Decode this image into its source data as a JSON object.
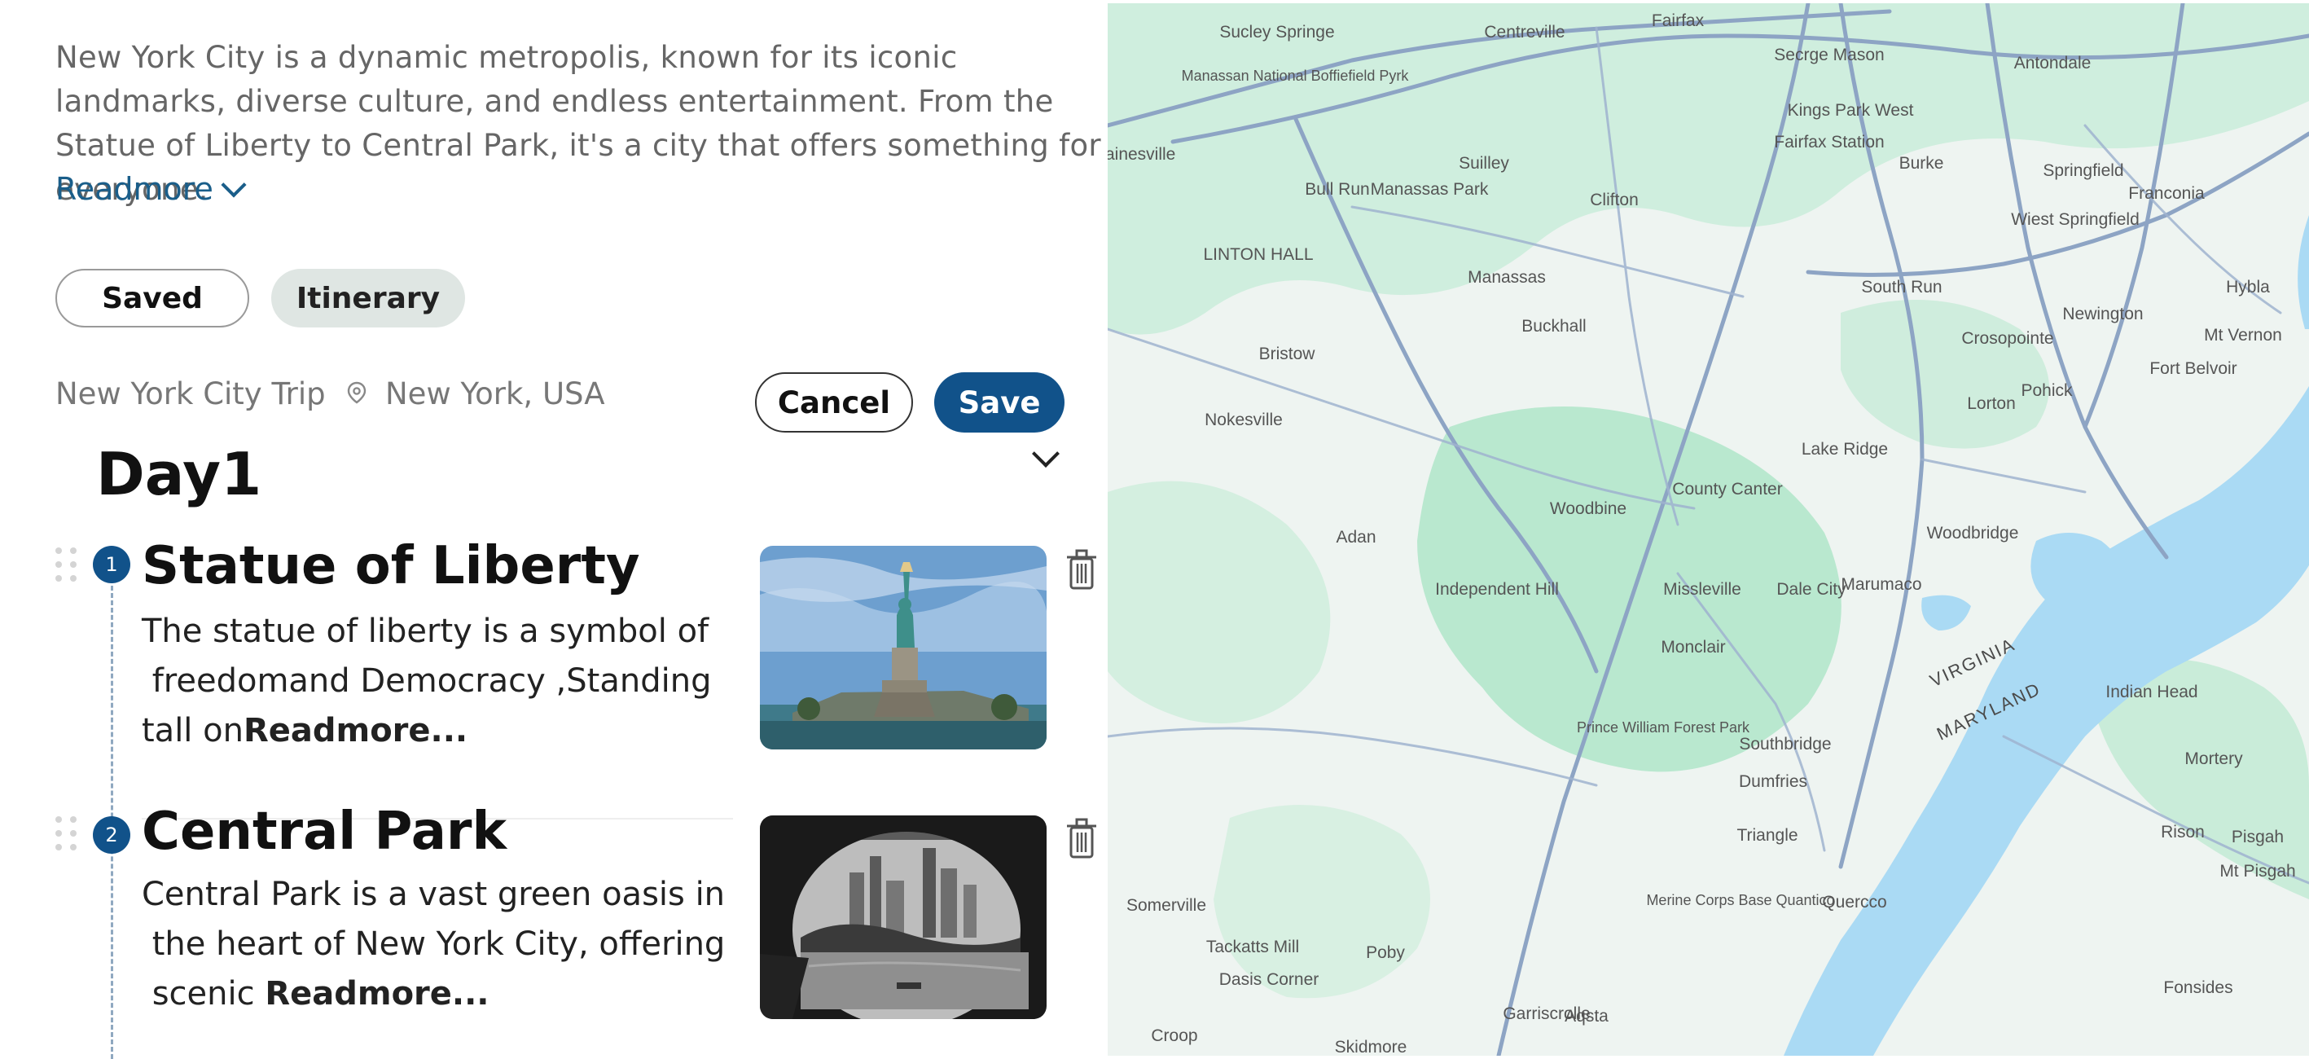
{
  "intro": {
    "text": "New York City is a dynamic metropolis, known for its iconic landmarks, diverse culture, and endless entertainment. From the Statue of Liberty to Central Park, it's a city that offers something for everyone.",
    "readmore_label": "Readmore"
  },
  "tabs": [
    {
      "label": "Saved",
      "active": false
    },
    {
      "label": "Itinerary",
      "active": true
    }
  ],
  "trip": {
    "name": "New York City Trip",
    "location": "New York, USA"
  },
  "actions": {
    "cancel_label": "Cancel",
    "save_label": "Save"
  },
  "day": {
    "title": "Day1"
  },
  "items": [
    {
      "number": "1",
      "title": "Statue of Liberty",
      "desc_lines": [
        "The statue of liberty is a symbol of",
        " freedomand Democracy ,Standing",
        "tall on"
      ],
      "readmore": "Readmore..."
    },
    {
      "number": "2",
      "title": "Central Park",
      "desc_lines": [
        "Central Park is a vast green oasis in",
        " the heart of New York City, offering",
        " scenic "
      ],
      "readmore": "Readmore..."
    }
  ],
  "map": {
    "labels": [
      "Sucley Springe",
      "Fairfax",
      "Centreville",
      "Secrge Mason",
      "Antondale",
      "Manassan National Boffiefield Pyrk",
      "Kings Park West",
      "Gainesville",
      "Fairfax Station",
      "Springfield",
      "Suilley",
      "Bull Run",
      "Manassas Park",
      "Burke",
      "Franconia",
      "Clifton",
      "Wiest Springfield",
      "LINTON HALL",
      "Manassas",
      "South Run",
      "Hybla",
      "Newington",
      "Buckhall",
      "Crosopointe",
      "Mt Vernon",
      "Bristow",
      "Fort Belvoir",
      "Lorton",
      "Pohick",
      "Nokesville",
      "Lake Ridge",
      "County Canter",
      "Woodbine",
      "Woodbridge",
      "Adan",
      "Independent Hill",
      "Missleville",
      "Dale City",
      "Marumaco",
      "Monclair",
      "VIRGINIA",
      "MARYLAND",
      "Indian Head",
      "Prince William Forest Park",
      "Southbridge",
      "Dumfries",
      "Mortery",
      "Triangle",
      "Rison",
      "Pisgah",
      "Mt Pisgah",
      "Merine Corps Base Quantico",
      "Quercco",
      "Somerville",
      "Tackatts Mill",
      "Dasis Corner",
      "Poby",
      "Fonsides",
      "Garriscrolle",
      "Aqsta",
      "Croop",
      "Skidmore"
    ],
    "colors": {
      "water": "#aadaf4",
      "park": "#c4ecd7",
      "land": "#eef4f1",
      "road": "#8da4c4"
    }
  }
}
